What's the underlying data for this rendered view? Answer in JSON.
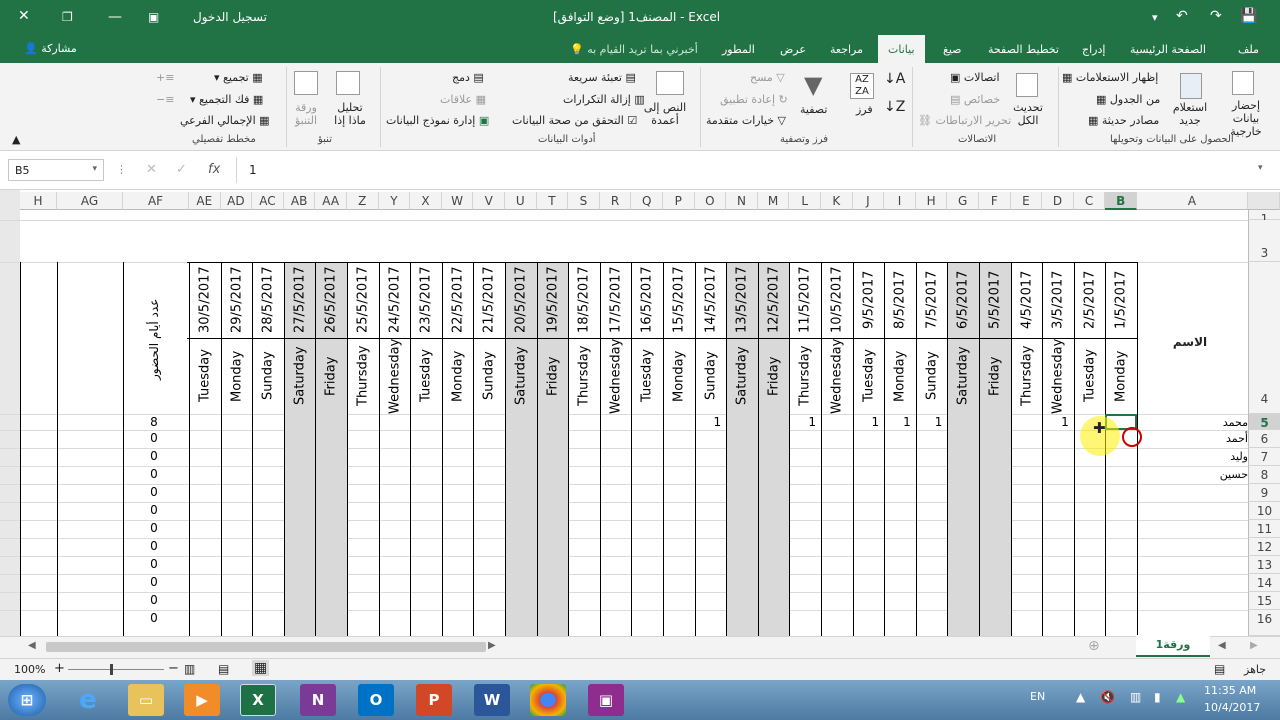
{
  "titlebar": {
    "title": "المصنف1 [وضع التوافق] - Excel",
    "signin": "تسجيل الدخول"
  },
  "ribbon_tabs": [
    "ملف",
    "الصفحة الرئيسية",
    "إدراج",
    "تخطيط الصفحة",
    "صيغ",
    "بيانات",
    "مراجعة",
    "عرض",
    "المطور"
  ],
  "active_tab": "بيانات",
  "tellme": "أخبرني بما تريد القيام به",
  "share": "مشاركة",
  "ribbon": {
    "get_external": "إحضار بيانات خارجية",
    "new_query": "استعلام جديد",
    "show_queries": "إظهار الاستعلامات",
    "from_table": "من الجدول",
    "recent_sources": "مصادر حديثة",
    "group_get": "الحصول على البيانات وتحويلها",
    "refresh_all": "تحديث الكل",
    "connections": "اتصالات",
    "properties": "خصائص",
    "edit_links": "تحرير الارتباطات",
    "group_conn": "الاتصالات",
    "sort_az": "فرز",
    "filter": "تصفية",
    "clear": "مسح",
    "reapply": "إعادة تطبيق",
    "advanced": "خيارات متقدمة",
    "group_sort": "فرز وتصفية",
    "text_to_cols": "النص إلى أعمدة",
    "flash_fill": "تعبئة سريعة",
    "remove_dup": "إزالة التكرارات",
    "validation": "التحقق من صحة البيانات",
    "consolidate": "دمج",
    "relationships": "علاقات",
    "manage_model": "إدارة نموذج البيانات",
    "group_tools": "أدوات البيانات",
    "whatif": "تحليل ماذا إذا",
    "forecast": "ورقة التنبؤ",
    "group_forecast": "تنبؤ",
    "group_btn": "تجميع",
    "ungroup": "فك التجميع",
    "subtotal": "الإجمالي الفرعي",
    "group_outline": "مخطط تفصيلي"
  },
  "formula": {
    "namebox": "B5",
    "value": "1"
  },
  "columns": [
    "A",
    "B",
    "C",
    "D",
    "E",
    "F",
    "G",
    "H",
    "I",
    "J",
    "K",
    "L",
    "M",
    "N",
    "O",
    "P",
    "Q",
    "R",
    "S",
    "T",
    "U",
    "V",
    "W",
    "X",
    "Y",
    "Z",
    "AA",
    "AB",
    "AC",
    "AD",
    "AE",
    "AF",
    "AG",
    "H"
  ],
  "dates": [
    "1/5/2017",
    "2/5/2017",
    "3/5/2017",
    "4/5/2017",
    "5/5/2017",
    "6/5/2017",
    "7/5/2017",
    "8/5/2017",
    "9/5/2017",
    "10/5/2017",
    "11/5/2017",
    "12/5/2017",
    "13/5/2017",
    "14/5/2017",
    "15/5/2017",
    "16/5/2017",
    "17/5/2017",
    "18/5/2017",
    "19/5/2017",
    "20/5/2017",
    "21/5/2017",
    "22/5/2017",
    "23/5/2017",
    "24/5/2017",
    "25/5/2017",
    "26/5/2017",
    "27/5/2017",
    "28/5/2017",
    "29/5/2017",
    "30/5/2017"
  ],
  "days": [
    "Monday",
    "Tuesday",
    "Wednesday",
    "Thursday",
    "Friday",
    "Saturday",
    "Sunday",
    "Monday",
    "Tuesday",
    "Wednesday",
    "Thursday",
    "Friday",
    "Saturday",
    "Sunday",
    "Monday",
    "Tuesday",
    "Wednesday",
    "Thursday",
    "Friday",
    "Saturday",
    "Sunday",
    "Monday",
    "Tuesday",
    "Wednesday",
    "Thursday",
    "Friday",
    "Saturday",
    "Sunday",
    "Monday",
    "Tuesday"
  ],
  "name_header": "الاسم",
  "count_header": "عدد أيام الحضور",
  "names": [
    "محمد",
    "أحمد",
    "وليد",
    "حسين"
  ],
  "counts": [
    "8",
    "0",
    "0",
    "0",
    "0",
    "0",
    "0",
    "0",
    "0",
    "0",
    "0",
    "0"
  ],
  "row_numbers": [
    "1",
    "3",
    "4",
    "5",
    "6",
    "7",
    "8",
    "9",
    "10",
    "11",
    "12",
    "13",
    "14",
    "15",
    "16"
  ],
  "ones": "1",
  "sheet_tab": "ورقة1",
  "status": {
    "ready": "جاهز",
    "zoom": "100%"
  },
  "taskbar": {
    "lang": "EN",
    "time": "11:35 AM",
    "date": "10/4/2017"
  }
}
